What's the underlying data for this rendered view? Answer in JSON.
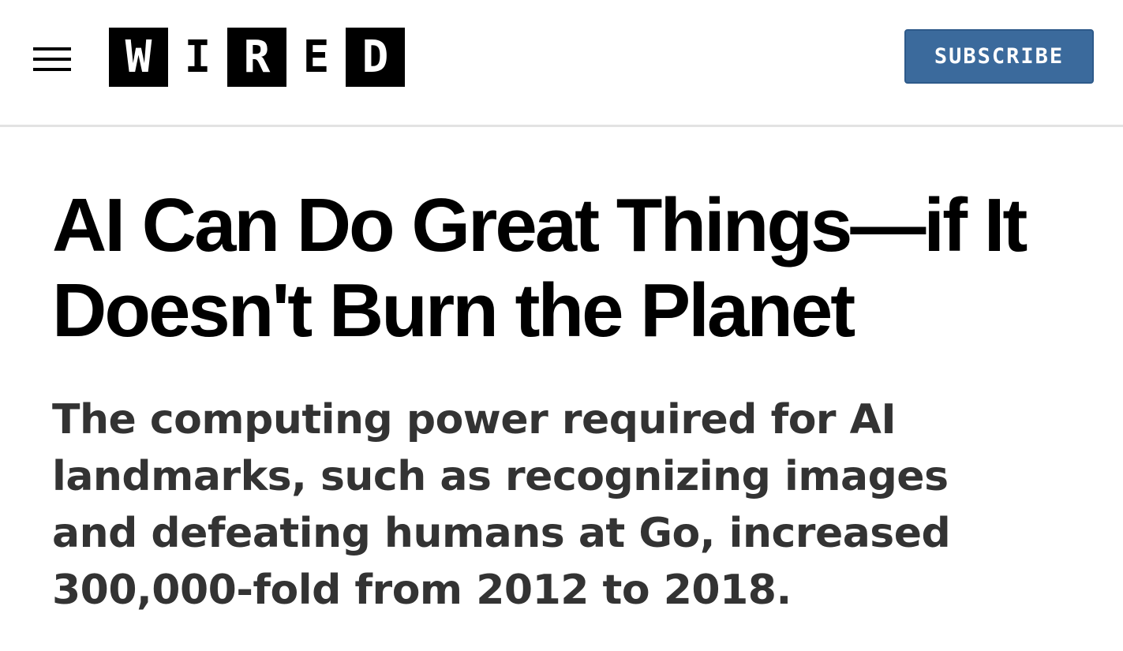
{
  "header": {
    "menu_icon": "hamburger-menu-icon",
    "logo_letters": [
      "W",
      "I",
      "R",
      "E",
      "D"
    ],
    "logo_label": "WIRED",
    "subscribe_label": "SUBSCRIBE",
    "subscribe_color": "#3b6a9c"
  },
  "article": {
    "headline": "AI Can Do Great Things—if It Doesn't Burn the Planet",
    "dek": "The computing power required for AI landmarks, such as recognizing images and defeating humans at Go, increased 300,000-fold from 2012 to 2018."
  }
}
